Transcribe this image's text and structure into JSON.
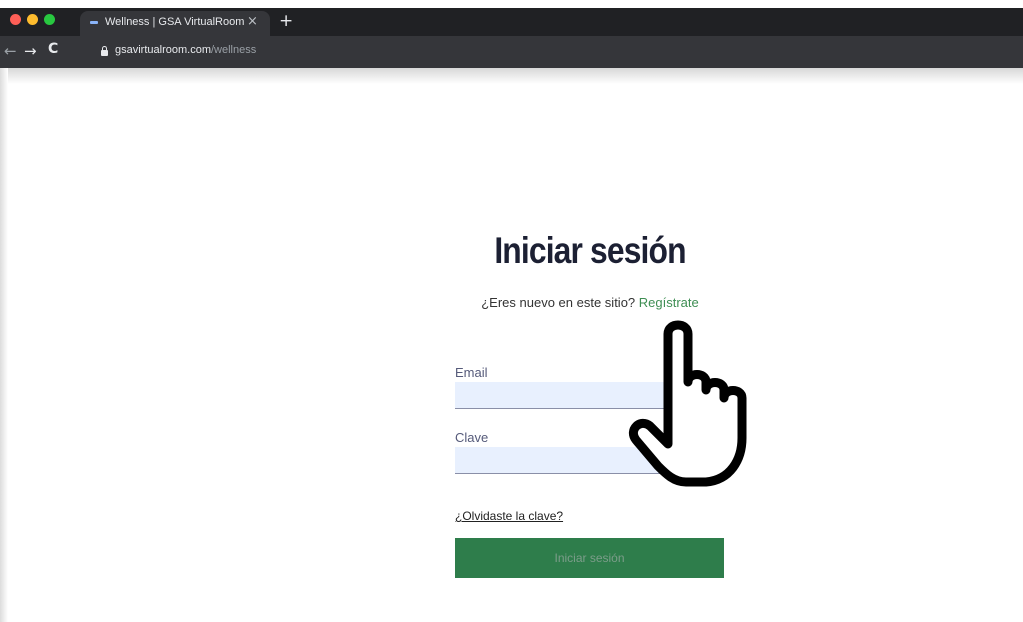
{
  "browser": {
    "tab_title": "Wellness | GSA VirtualRoom",
    "tab_close": "×",
    "new_tab": "+",
    "url_host": "gsavirtualroom.com",
    "url_path": "/wellness",
    "nav_back": "←",
    "nav_forward": "→",
    "nav_reload": "C"
  },
  "login": {
    "title": "Iniciar sesión",
    "subtitle_prefix": "¿Eres nuevo en este sitio? ",
    "signup_link": "Regístrate",
    "email_label": "Email",
    "email_value": "",
    "password_label": "Clave",
    "password_value": "",
    "forgot_link": "¿Olvidaste la clave?",
    "submit_label": "Iniciar sesión"
  },
  "overlay": {
    "icon": "pointing-hand-icon"
  },
  "colors": {
    "accent_green": "#2e7d4b",
    "link_green": "#3e8e53",
    "title_navy": "#1c2033",
    "input_bg": "#e8f0fe",
    "chrome_dark": "#202124"
  }
}
